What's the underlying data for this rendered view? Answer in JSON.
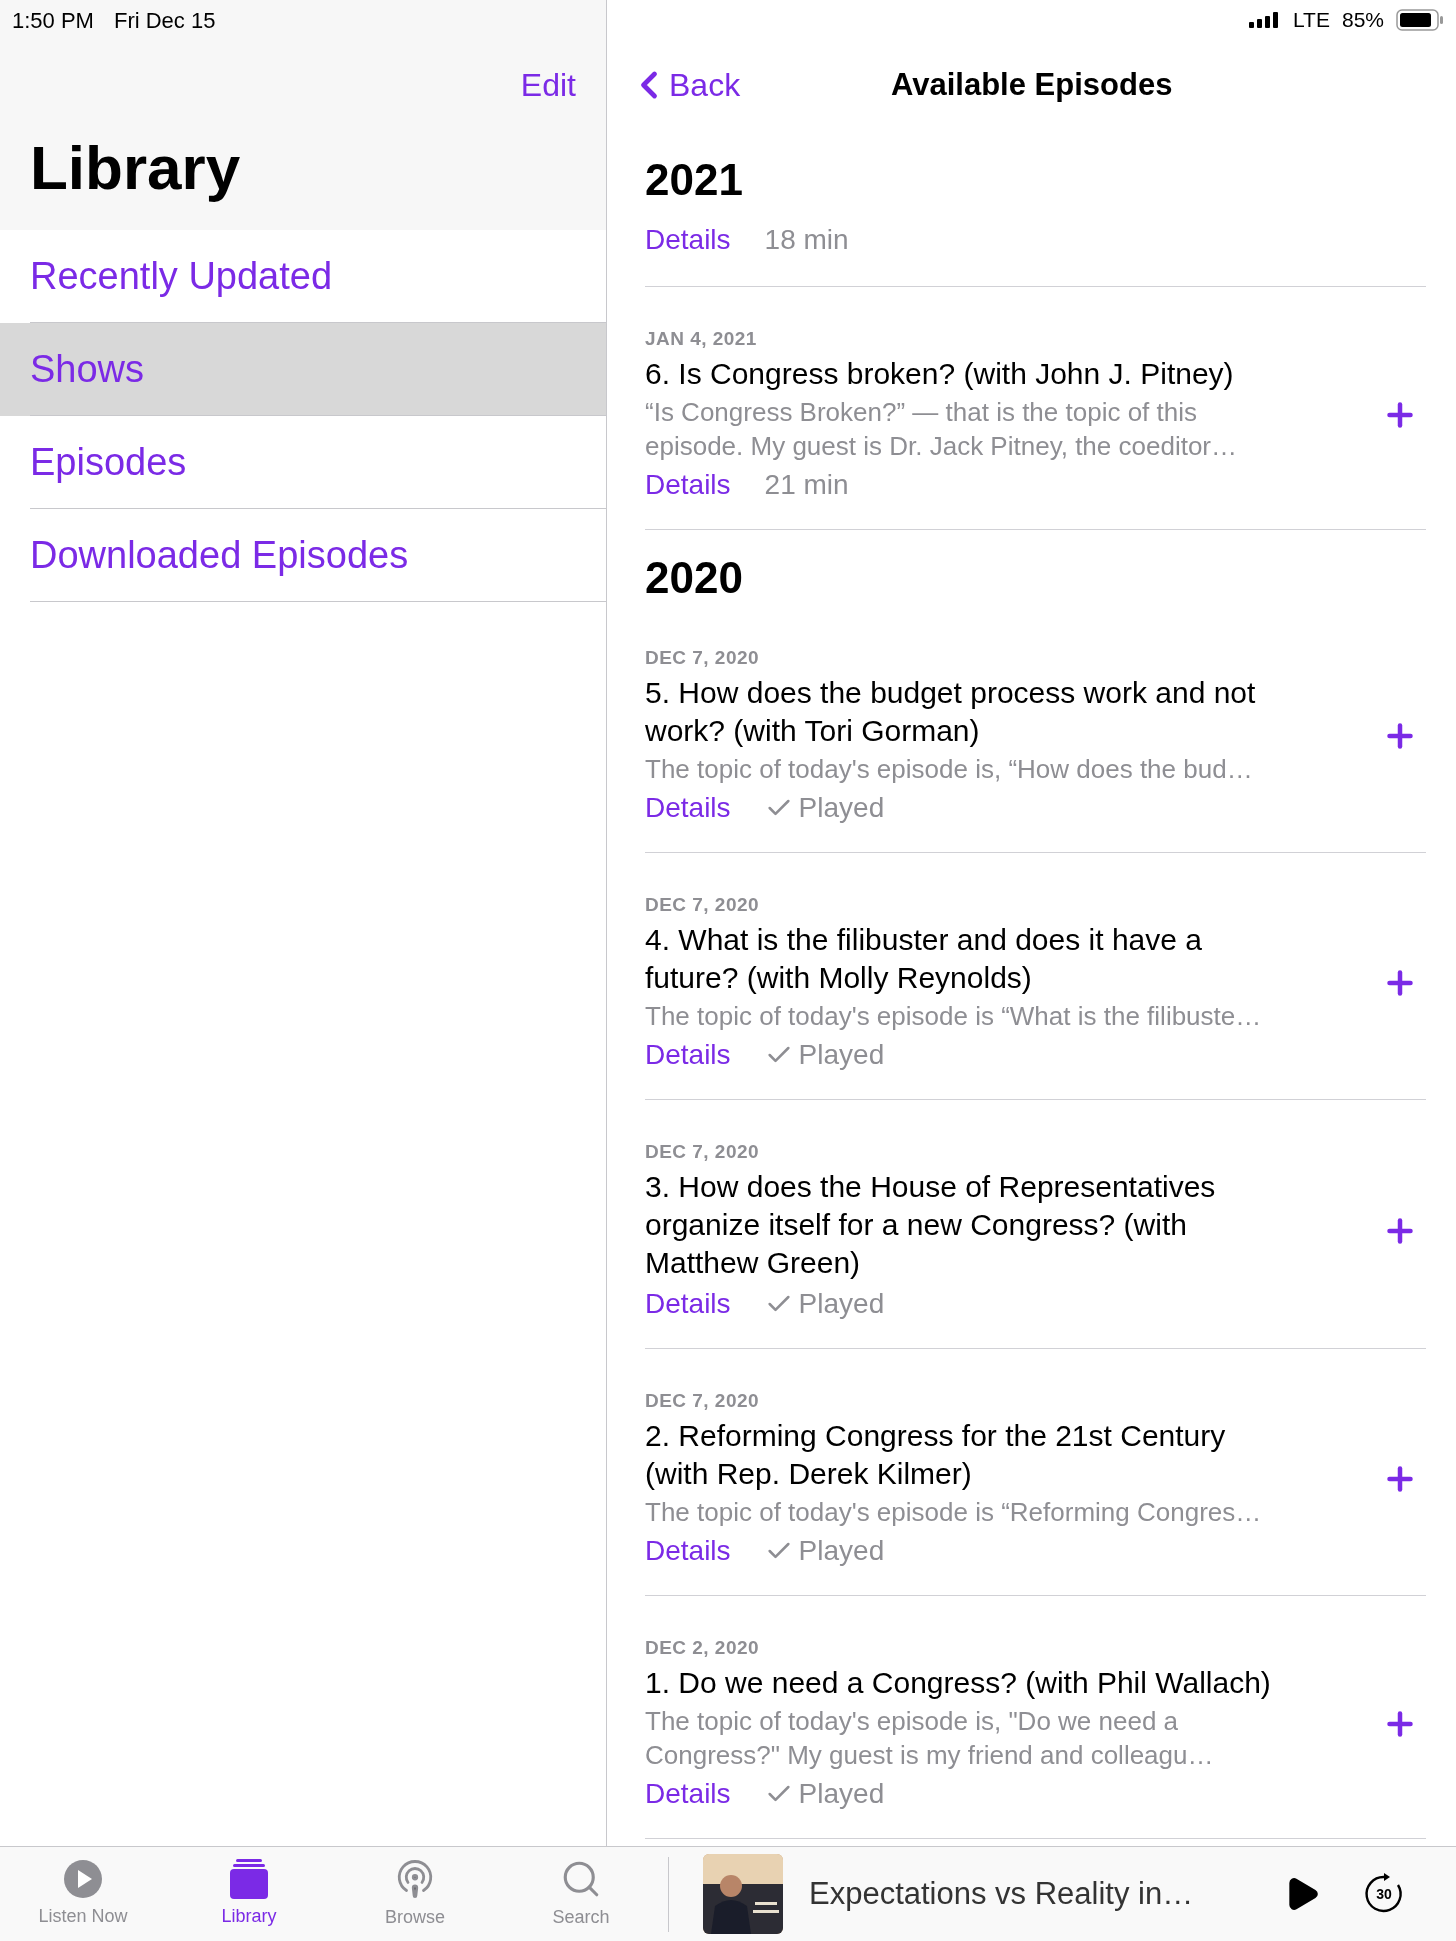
{
  "status_bar": {
    "time": "1:50 PM",
    "date": "Fri Dec 15",
    "network": "LTE",
    "battery": "85%"
  },
  "sidebar": {
    "edit": "Edit",
    "title": "Library",
    "items": [
      {
        "label": "Recently Updated",
        "selected": false
      },
      {
        "label": "Shows",
        "selected": true
      },
      {
        "label": "Episodes",
        "selected": false
      },
      {
        "label": "Downloaded Episodes",
        "selected": false
      }
    ]
  },
  "nav": {
    "back": "Back",
    "title": "Available Episodes"
  },
  "sections": [
    {
      "year": "2021",
      "episodes": [
        {
          "details": "Details",
          "meta": "18 min",
          "played": false
        },
        {
          "date": "JAN 4, 2021",
          "title": "6. Is Congress broken? (with John J. Pitney)",
          "description": "“Is Congress Broken?” — that is the topic of this episode. My guest is Dr. Jack Pitney, the coeditor…",
          "details": "Details",
          "meta": "21 min",
          "played": false
        }
      ]
    },
    {
      "year": "2020",
      "episodes": [
        {
          "date": "DEC 7, 2020",
          "title": "5. How does the budget process work and not work? (with Tori Gorman)",
          "description": "The topic of today's episode is, “How does the bud…",
          "details": "Details",
          "meta": "Played",
          "played": true
        },
        {
          "date": "DEC 7, 2020",
          "title": "4. What is the filibuster and does it have a future? (with Molly Reynolds)",
          "description": "The topic of today's episode is “What is the filibuste…",
          "details": "Details",
          "meta": "Played",
          "played": true
        },
        {
          "date": "DEC 7, 2020",
          "title": "3. How does the House of Representatives organize itself for a new Congress? (with Matthew Green)",
          "details": "Details",
          "meta": "Played",
          "played": true
        },
        {
          "date": "DEC 7, 2020",
          "title": "2. Reforming Congress for the 21st Century (with Rep. Derek Kilmer)",
          "description": "The topic of today's episode is “Reforming Congres…",
          "details": "Details",
          "meta": "Played",
          "played": true
        },
        {
          "date": "DEC 2, 2020",
          "title": "1. Do we need a Congress? (with Phil Wallach)",
          "description": "The topic of today's episode is, \"Do we need a Congress?\" My guest is my friend and colleagu…",
          "details": "Details",
          "meta": "Played",
          "played": true
        }
      ]
    }
  ],
  "tab_bar": {
    "tabs": [
      {
        "kind": "listen_now",
        "label": "Listen Now",
        "selected": false
      },
      {
        "kind": "library",
        "label": "Library",
        "selected": true
      },
      {
        "kind": "browse",
        "label": "Browse",
        "selected": false
      },
      {
        "kind": "search",
        "label": "Search",
        "selected": false
      }
    ]
  },
  "now_playing": {
    "kind": "picture",
    "title": "Expectations vs Reality in…",
    "skip": "30"
  }
}
